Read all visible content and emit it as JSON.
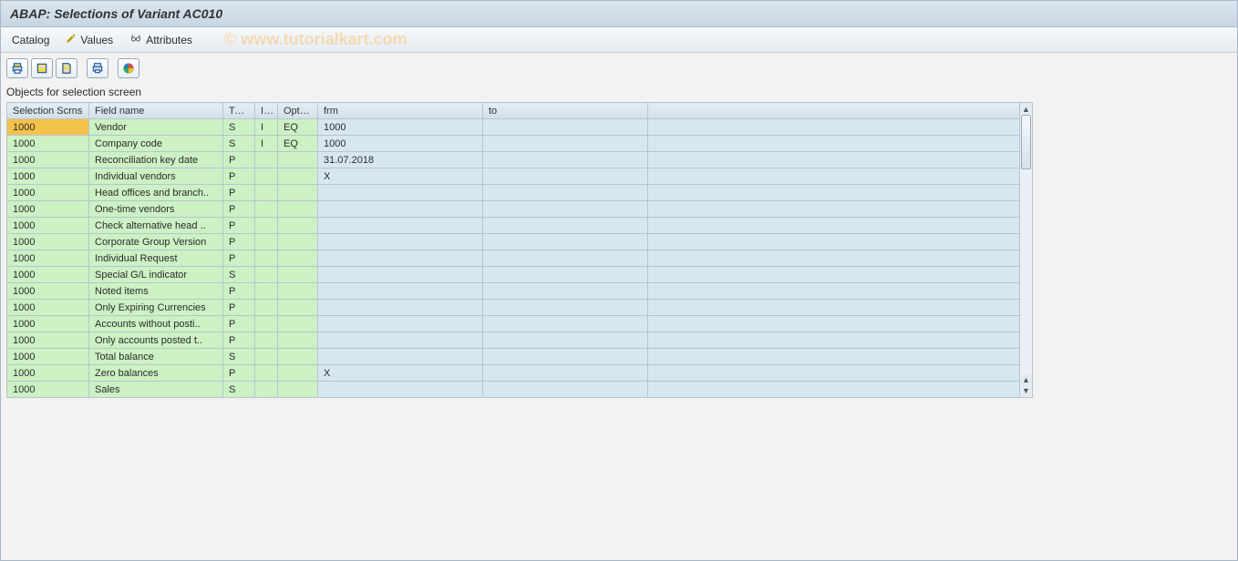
{
  "title": "ABAP: Selections of Variant AC010",
  "menu": {
    "catalog": "Catalog",
    "values": "Values",
    "attributes": "Attributes"
  },
  "watermark": "© www.tutorialkart.com",
  "list_label": "Objects for selection screen",
  "headers": {
    "scrns": "Selection Scrns",
    "fname": "Field name",
    "type": "Type",
    "ie": "I/E",
    "option": "Option",
    "frm": "frm",
    "to": "to"
  },
  "rows": [
    {
      "sel": true,
      "scrn": "1000",
      "name": "Vendor",
      "type": "S",
      "ie": "I",
      "opt": "EQ",
      "frm": "1000",
      "to": ""
    },
    {
      "sel": false,
      "scrn": "1000",
      "name": "Company code",
      "type": "S",
      "ie": "I",
      "opt": "EQ",
      "frm": "1000",
      "to": ""
    },
    {
      "sel": false,
      "scrn": "1000",
      "name": "Reconciliation key date",
      "type": "P",
      "ie": "",
      "opt": "",
      "frm": "31.07.2018",
      "to": ""
    },
    {
      "sel": false,
      "scrn": "1000",
      "name": "Individual vendors",
      "type": "P",
      "ie": "",
      "opt": "",
      "frm": "X",
      "to": ""
    },
    {
      "sel": false,
      "scrn": "1000",
      "name": "Head offices and branch..",
      "type": "P",
      "ie": "",
      "opt": "",
      "frm": "",
      "to": ""
    },
    {
      "sel": false,
      "scrn": "1000",
      "name": "One-time vendors",
      "type": "P",
      "ie": "",
      "opt": "",
      "frm": "",
      "to": ""
    },
    {
      "sel": false,
      "scrn": "1000",
      "name": "Check alternative head ..",
      "type": "P",
      "ie": "",
      "opt": "",
      "frm": "",
      "to": ""
    },
    {
      "sel": false,
      "scrn": "1000",
      "name": "Corporate Group Version",
      "type": "P",
      "ie": "",
      "opt": "",
      "frm": "",
      "to": ""
    },
    {
      "sel": false,
      "scrn": "1000",
      "name": "Individual Request",
      "type": "P",
      "ie": "",
      "opt": "",
      "frm": "",
      "to": ""
    },
    {
      "sel": false,
      "scrn": "1000",
      "name": "Special G/L indicator",
      "type": "S",
      "ie": "",
      "opt": "",
      "frm": "",
      "to": ""
    },
    {
      "sel": false,
      "scrn": "1000",
      "name": "Noted items",
      "type": "P",
      "ie": "",
      "opt": "",
      "frm": "",
      "to": ""
    },
    {
      "sel": false,
      "scrn": "1000",
      "name": "Only Expiring Currencies",
      "type": "P",
      "ie": "",
      "opt": "",
      "frm": "",
      "to": ""
    },
    {
      "sel": false,
      "scrn": "1000",
      "name": "Accounts without posti..",
      "type": "P",
      "ie": "",
      "opt": "",
      "frm": "",
      "to": ""
    },
    {
      "sel": false,
      "scrn": "1000",
      "name": "Only accounts posted t..",
      "type": "P",
      "ie": "",
      "opt": "",
      "frm": "",
      "to": ""
    },
    {
      "sel": false,
      "scrn": "1000",
      "name": "Total balance",
      "type": "S",
      "ie": "",
      "opt": "",
      "frm": "",
      "to": ""
    },
    {
      "sel": false,
      "scrn": "1000",
      "name": "Zero balances",
      "type": "P",
      "ie": "",
      "opt": "",
      "frm": "X",
      "to": ""
    },
    {
      "sel": false,
      "scrn": "1000",
      "name": "Sales",
      "type": "S",
      "ie": "",
      "opt": "",
      "frm": "",
      "to": ""
    }
  ]
}
